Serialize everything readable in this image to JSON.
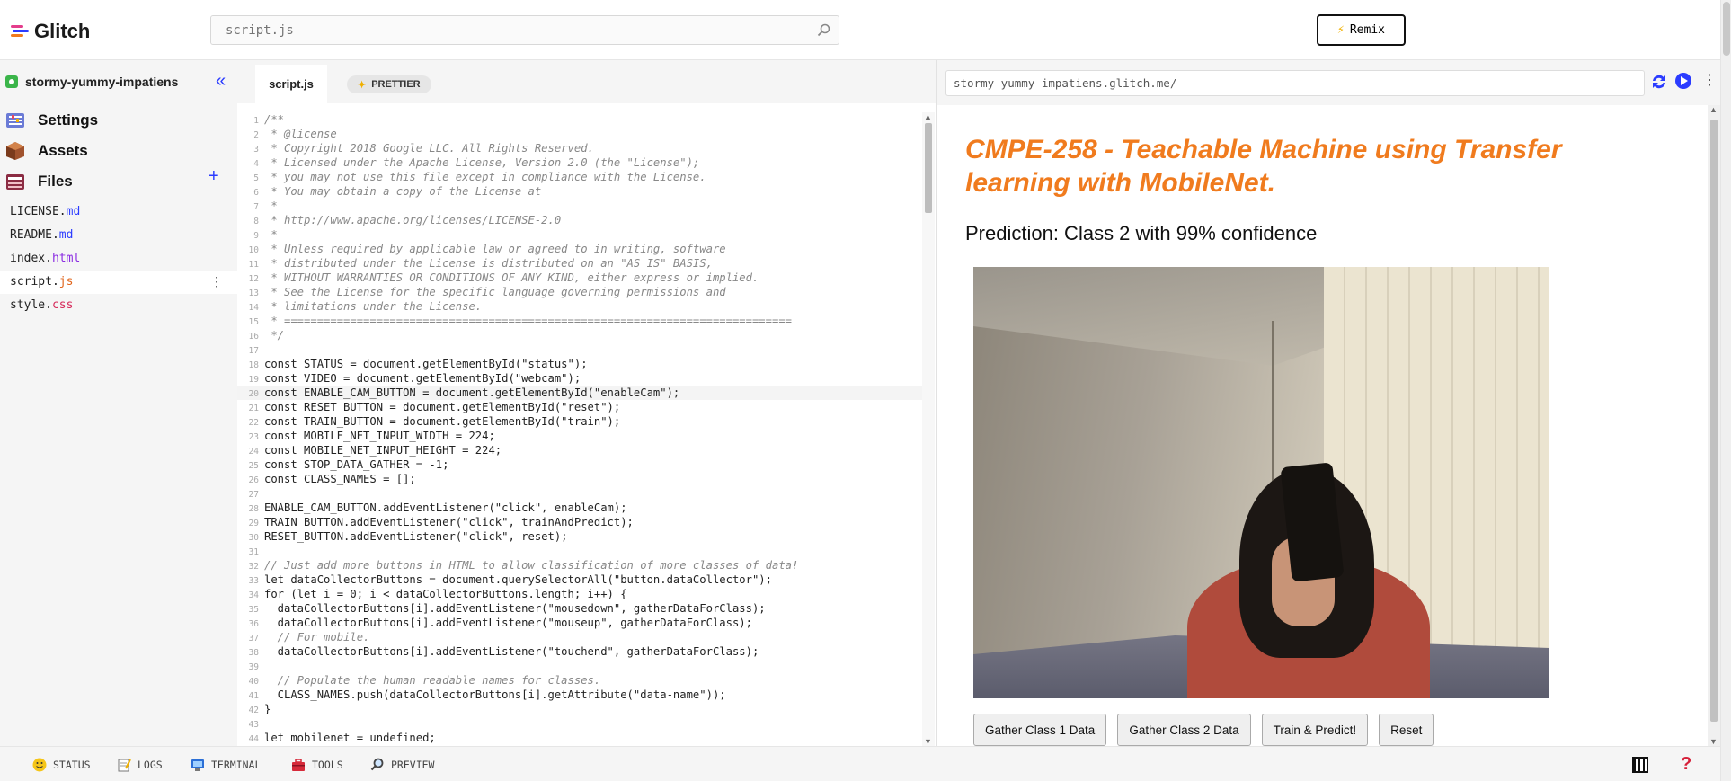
{
  "app": {
    "name": "Glitch"
  },
  "search": {
    "placeholder": "script.js"
  },
  "remix_label": "Remix",
  "sidebar": {
    "project_name": "stormy-yummy-impatiens",
    "nav": [
      {
        "label": "Settings"
      },
      {
        "label": "Assets"
      },
      {
        "label": "Files"
      }
    ],
    "files": [
      {
        "base": "LICENSE.",
        "ext": "md",
        "type": "md"
      },
      {
        "base": "README.",
        "ext": "md",
        "type": "md"
      },
      {
        "base": "index.",
        "ext": "html",
        "type": "html"
      },
      {
        "base": "script.",
        "ext": "js",
        "type": "js"
      },
      {
        "base": "style.",
        "ext": "css",
        "type": "css"
      }
    ]
  },
  "editor": {
    "active_tab": "script.js",
    "prettier_label": "PRETTIER",
    "lines": [
      "/**",
      " * @license",
      " * Copyright 2018 Google LLC. All Rights Reserved.",
      " * Licensed under the Apache License, Version 2.0 (the \"License\");",
      " * you may not use this file except in compliance with the License.",
      " * You may obtain a copy of the License at",
      " *",
      " * http://www.apache.org/licenses/LICENSE-2.0",
      " *",
      " * Unless required by applicable law or agreed to in writing, software",
      " * distributed under the License is distributed on an \"AS IS\" BASIS,",
      " * WITHOUT WARRANTIES OR CONDITIONS OF ANY KIND, either express or implied.",
      " * See the License for the specific language governing permissions and",
      " * limitations under the License.",
      " * =============================================================================",
      " */",
      "",
      "const STATUS = document.getElementById(\"status\");",
      "const VIDEO = document.getElementById(\"webcam\");",
      "const ENABLE_CAM_BUTTON = document.getElementById(\"enableCam\");",
      "const RESET_BUTTON = document.getElementById(\"reset\");",
      "const TRAIN_BUTTON = document.getElementById(\"train\");",
      "const MOBILE_NET_INPUT_WIDTH = 224;",
      "const MOBILE_NET_INPUT_HEIGHT = 224;",
      "const STOP_DATA_GATHER = -1;",
      "const CLASS_NAMES = [];",
      "",
      "ENABLE_CAM_BUTTON.addEventListener(\"click\", enableCam);",
      "TRAIN_BUTTON.addEventListener(\"click\", trainAndPredict);",
      "RESET_BUTTON.addEventListener(\"click\", reset);",
      "",
      "// Just add more buttons in HTML to allow classification of more classes of data!",
      "let dataCollectorButtons = document.querySelectorAll(\"button.dataCollector\");",
      "for (let i = 0; i < dataCollectorButtons.length; i++) {",
      "  dataCollectorButtons[i].addEventListener(\"mousedown\", gatherDataForClass);",
      "  dataCollectorButtons[i].addEventListener(\"mouseup\", gatherDataForClass);",
      "  // For mobile.",
      "  dataCollectorButtons[i].addEventListener(\"touchend\", gatherDataForClass);",
      "",
      "  // Populate the human readable names for classes.",
      "  CLASS_NAMES.push(dataCollectorButtons[i].getAttribute(\"data-name\"));",
      "}",
      "",
      "let mobilenet = undefined;"
    ],
    "highlighted_line": 20
  },
  "preview": {
    "url": "stormy-yummy-impatiens.glitch.me/",
    "heading": "CMPE-258 - Teachable Machine using Transfer learning with MobileNet.",
    "prediction": "Prediction: Class 2 with 99% confidence",
    "buttons": [
      {
        "label": "Gather Class 1 Data"
      },
      {
        "label": "Gather Class 2 Data"
      },
      {
        "label": "Train & Predict!"
      },
      {
        "label": "Reset"
      }
    ],
    "heading_color": "#f07b1e"
  },
  "bottombar": {
    "items": [
      {
        "label": "STATUS",
        "icon": "smiley-icon"
      },
      {
        "label": "LOGS",
        "icon": "notepad-icon"
      },
      {
        "label": "TERMINAL",
        "icon": "terminal-icon"
      },
      {
        "label": "TOOLS",
        "icon": "toolbox-icon"
      },
      {
        "label": "PREVIEW",
        "icon": "magnifier-icon"
      }
    ]
  }
}
